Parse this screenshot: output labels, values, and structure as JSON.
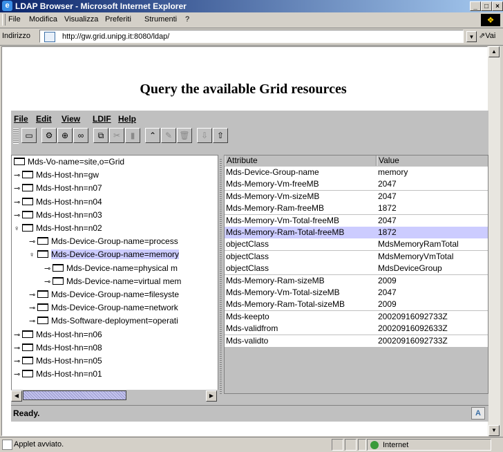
{
  "window": {
    "title": "LDAP Browser - Microsoft Internet Explorer"
  },
  "menu": [
    "File",
    "Modifica",
    "Visualizza",
    "Preferiti",
    "Strumenti",
    "?"
  ],
  "address": {
    "label": "Indirizzo",
    "url": "http://gw.grid.unipg.it:8080/ldap/",
    "go": "Vai"
  },
  "page": {
    "heading": "Query the available Grid resources"
  },
  "applet": {
    "menu": [
      "File",
      "Edit",
      "View",
      "LDIF",
      "Help"
    ],
    "toolbar_icons": [
      "computer-icon",
      "connect-icon",
      "search-icon",
      "binoculars-icon",
      "copy-icon",
      "cut-icon",
      "paste-icon",
      "up-icon",
      "edit-icon",
      "delete-icon",
      "import-icon",
      "export-icon"
    ],
    "tree": [
      {
        "label": "Mds-Vo-name=site,o=Grid",
        "level": 0,
        "expander": "",
        "selected": false
      },
      {
        "label": "Mds-Host-hn=gw",
        "level": 0,
        "expander": "⚬",
        "selected": false
      },
      {
        "label": "Mds-Host-hn=n07",
        "level": 0,
        "expander": "⚬",
        "selected": false
      },
      {
        "label": "Mds-Host-hn=n04",
        "level": 0,
        "expander": "⚬",
        "selected": false
      },
      {
        "label": "Mds-Host-hn=n03",
        "level": 0,
        "expander": "⚬",
        "selected": false
      },
      {
        "label": "Mds-Host-hn=n02",
        "level": 0,
        "expander": "♀",
        "selected": false
      },
      {
        "label": "Mds-Device-Group-name=process",
        "level": 1,
        "expander": "⚬",
        "selected": false
      },
      {
        "label": "Mds-Device-Group-name=memory",
        "level": 1,
        "expander": "♀",
        "selected": true
      },
      {
        "label": "Mds-Device-name=physical m",
        "level": 2,
        "expander": "⚬",
        "selected": false
      },
      {
        "label": "Mds-Device-name=virtual mem",
        "level": 2,
        "expander": "⚬",
        "selected": false
      },
      {
        "label": "Mds-Device-Group-name=filesyste",
        "level": 1,
        "expander": "⚬",
        "selected": false
      },
      {
        "label": "Mds-Device-Group-name=network",
        "level": 1,
        "expander": "⚬",
        "selected": false
      },
      {
        "label": "Mds-Software-deployment=operati",
        "level": 1,
        "expander": "⚬",
        "selected": false
      },
      {
        "label": "Mds-Host-hn=n06",
        "level": 0,
        "expander": "⚬",
        "selected": false
      },
      {
        "label": "Mds-Host-hn=n08",
        "level": 0,
        "expander": "⚬",
        "selected": false
      },
      {
        "label": "Mds-Host-hn=n05",
        "level": 0,
        "expander": "⚬",
        "selected": false
      },
      {
        "label": "Mds-Host-hn=n01",
        "level": 0,
        "expander": "⚬",
        "selected": false
      }
    ],
    "table": {
      "headers": [
        "Attribute",
        "Value"
      ],
      "rows": [
        [
          "Mds-Device-Group-name",
          "memory"
        ],
        [
          "Mds-Memory-Vm-freeMB",
          "2047"
        ],
        [
          "Mds-Memory-Vm-sizeMB",
          "2047"
        ],
        [
          "Mds-Memory-Ram-freeMB",
          "1872"
        ],
        [
          "Mds-Memory-Vm-Total-freeMB",
          "2047"
        ],
        [
          "Mds-Memory-Ram-Total-freeMB",
          "1872"
        ],
        [
          "objectClass",
          "MdsMemoryRamTotal"
        ],
        [
          "objectClass",
          "MdsMemoryVmTotal"
        ],
        [
          "objectClass",
          "MdsDeviceGroup"
        ],
        [
          "Mds-Memory-Ram-sizeMB",
          "2009"
        ],
        [
          "Mds-Memory-Vm-Total-sizeMB",
          "2047"
        ],
        [
          "Mds-Memory-Ram-Total-sizeMB",
          "2009"
        ],
        [
          "Mds-keepto",
          "20020916092733Z"
        ],
        [
          "Mds-validfrom",
          "20020916092633Z"
        ],
        [
          "Mds-validto",
          "20020916092733Z"
        ]
      ],
      "selected_row": 5
    },
    "status": "Ready.",
    "status_badge": "A"
  },
  "statusbar": {
    "text": "Applet avviato.",
    "zone": "Internet"
  }
}
